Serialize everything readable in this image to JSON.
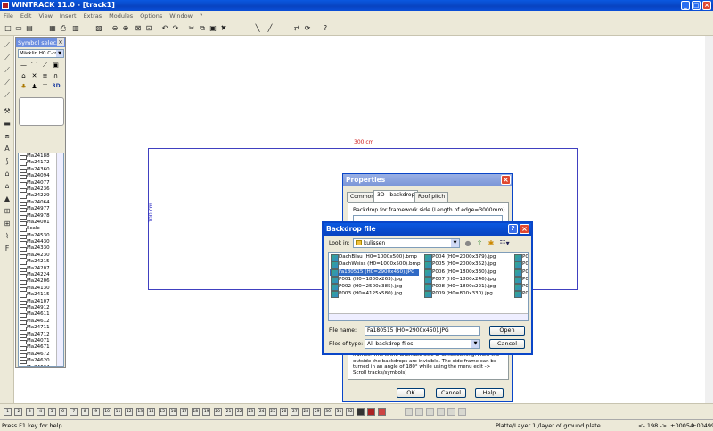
{
  "window": {
    "title": "WINTRACK 11.0 - [track1]"
  },
  "menu": [
    "File",
    "Edit",
    "View",
    "Insert",
    "Extras",
    "Modules",
    "Options",
    "Window",
    "?"
  ],
  "toolbar_icons": [
    "new-icon",
    "open-icon",
    "save-icon",
    "print-preview-icon",
    "print-icon",
    "calculator-icon",
    "image-icon",
    "zoom-out-icon",
    "zoom-in-icon",
    "zoom-window-icon",
    "zoom-all-icon",
    "undo-icon",
    "redo-icon",
    "cut-icon",
    "copy-icon",
    "paste-icon",
    "delete-icon",
    "select-icon",
    "draw-line-icon",
    "move-icon",
    "rotate-icon",
    "help-pointer-icon"
  ],
  "symbol_panel": {
    "title": "Symbol selec...",
    "catalog": "Märklin H0 C-tra",
    "items": [
      "Ma24188",
      "Ma24172",
      "Ma24360",
      "Ma24094",
      "Ma24077",
      "Ma24236",
      "Ma24229",
      "Ma24064",
      "Ma24977",
      "Ma24978",
      "Ma24001",
      "Scale",
      "Ma24530",
      "Ma24430",
      "Ma24330",
      "Ma24230",
      "Ma24215",
      "Ma24207",
      "Ma24224",
      "Ma24206",
      "Ma24130",
      "Ma24115",
      "Ma24107",
      "Ma24912",
      "Ma24611",
      "Ma24612",
      "Ma24711",
      "Ma24712",
      "Ma24071",
      "Ma24671",
      "Ma24672",
      "Ma24620",
      "Ma24624"
    ]
  },
  "canvas": {
    "width_label": "300 cm",
    "height_label": "100 cm"
  },
  "properties": {
    "title": "Properties",
    "tabs": [
      "Common",
      "3D - backdrop",
      "Roof pitch"
    ],
    "backdrop_label": "Backdrop for framework side (Length of edge=3000mm).",
    "info_text": "frames. This is the alternate side of dimensioning. From the outside the backdrops are invisible. The side frame can be turned in an angle of 180° while using the menu edit -> Scroll tracks/symbols)",
    "ok": "OK",
    "cancel": "Cancel",
    "help": "Help"
  },
  "backdrop_file": {
    "title": "Backdrop file",
    "look_in_label": "Look in:",
    "look_in": "kulissen",
    "col1": [
      "DachBlau (H0=1000x500).bmp",
      "DachWeiss (H0=1000x500).bmp",
      "Fa180515 (H0=2900x450).JPG",
      "P001 (H0=1800x263).jpg",
      "P002 (H0=2500x385).jpg",
      "P003 (H0=4125x580).jpg"
    ],
    "col2": [
      "P004 (H0=2000x379).jpg",
      "P005 (H0=2000x352).jpg",
      "P006 (H0=1800x330).jpg",
      "P007 (H0=1800x246).jpg",
      "P008 (H0=1800x221).jpg",
      "P009 (H0=800x330).jpg"
    ],
    "col3": [
      "P01",
      "P01",
      "P01",
      "P01",
      "P01",
      "P01"
    ],
    "selected_index": 2,
    "file_name_label": "File name:",
    "file_name": "Fa180515 (H0=2900x450).JPG",
    "file_type_label": "Files of type:",
    "file_type": "All backdrop files",
    "open": "Open",
    "cancel": "Cancel"
  },
  "layer_buttons": [
    "1",
    "2",
    "3",
    "4",
    "5",
    "6",
    "7",
    "8",
    "9",
    "10",
    "11",
    "12",
    "13",
    "14",
    "15",
    "16",
    "17",
    "18",
    "19",
    "20",
    "21",
    "22",
    "23",
    "24",
    "25",
    "26",
    "27",
    "28",
    "29",
    "30",
    "31",
    "32"
  ],
  "status": {
    "help": "Press F1 key for help",
    "layer": "Platte/Layer 1 /layer of ground plate",
    "zoom": "<- 198 ->",
    "x": "+00054",
    "y": "+00499"
  }
}
